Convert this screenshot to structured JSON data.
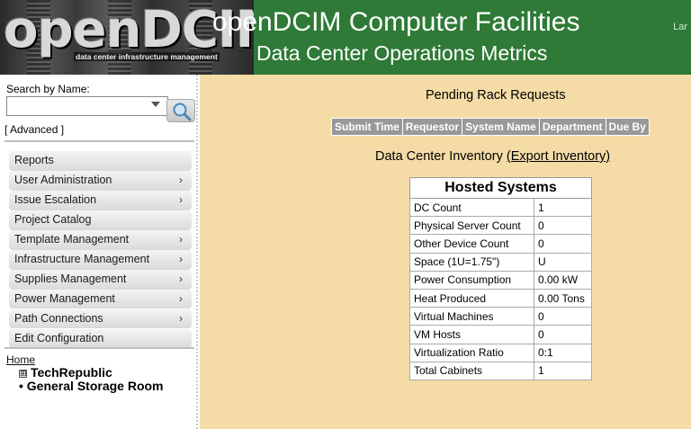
{
  "header": {
    "logo_text": "openDCIM",
    "logo_tagline": "data center infrastructure management",
    "title_line1": "openDCIM Computer Facilities",
    "title_line2": "Data Center Operations Metrics",
    "right_text": "Lar"
  },
  "sidebar": {
    "search_label": "Search by Name:",
    "search_value": "",
    "advanced_link": "[ Advanced ]",
    "menu": [
      {
        "label": "Reports",
        "has_submenu": false
      },
      {
        "label": "User Administration",
        "has_submenu": true
      },
      {
        "label": "Issue Escalation",
        "has_submenu": true
      },
      {
        "label": "Project Catalog",
        "has_submenu": false
      },
      {
        "label": "Template Management",
        "has_submenu": true
      },
      {
        "label": "Infrastructure Management",
        "has_submenu": true
      },
      {
        "label": "Supplies Management",
        "has_submenu": true
      },
      {
        "label": "Power Management",
        "has_submenu": true
      },
      {
        "label": "Path Connections",
        "has_submenu": true
      },
      {
        "label": "Edit Configuration",
        "has_submenu": false
      }
    ],
    "tree": {
      "home": "Home",
      "nodes": [
        {
          "label": "TechRepublic",
          "expand_symbol": "⊞"
        },
        {
          "label": "General Storage Room",
          "bullet": "•"
        }
      ]
    }
  },
  "main": {
    "pending_title": "Pending Rack Requests",
    "request_columns": [
      "Submit Time",
      "Requestor",
      "System Name",
      "Department",
      "Due By"
    ],
    "inventory_label": "Data Center Inventory",
    "export_link": "(Export Inventory)",
    "hosted_title": "Hosted Systems",
    "hosted_rows": [
      {
        "label": "DC Count",
        "value": "1"
      },
      {
        "label": "Physical Server Count",
        "value": "0"
      },
      {
        "label": "Other Device Count",
        "value": "0"
      },
      {
        "label": "Space (1U=1.75\")",
        "value": "U"
      },
      {
        "label": "Power Consumption",
        "value": "0.00 kW"
      },
      {
        "label": "Heat Produced",
        "value": "0.00 Tons"
      },
      {
        "label": "Virtual Machines",
        "value": "0"
      },
      {
        "label": "VM Hosts",
        "value": "0"
      },
      {
        "label": "Virtualization Ratio",
        "value": "0:1"
      },
      {
        "label": "Total Cabinets",
        "value": "1"
      }
    ]
  },
  "colors": {
    "header_green": "#2e7a36",
    "main_background": "#f5dca6",
    "table_header_gray": "#999999"
  }
}
